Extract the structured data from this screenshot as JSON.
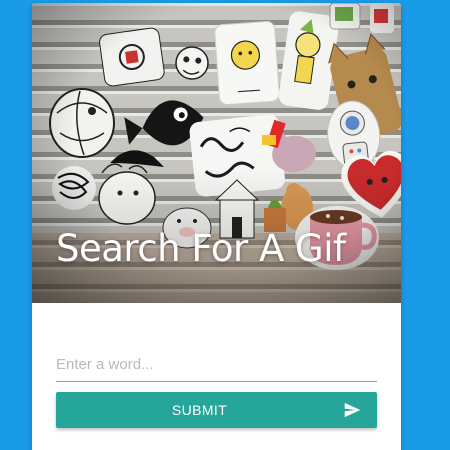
{
  "hero": {
    "title": "Search For A Gif",
    "image_icon": "sticker-collage-photo"
  },
  "search": {
    "placeholder": "Enter a word...",
    "value": ""
  },
  "submit": {
    "label": "SUBMIT",
    "icon": "send-icon"
  },
  "colors": {
    "page_background": "#1a9be8",
    "card_background": "#ffffff",
    "button": "#26a69a",
    "button_text": "#ffffff",
    "input_underline": "#9e9e9e",
    "placeholder": "#b9b9b9"
  }
}
